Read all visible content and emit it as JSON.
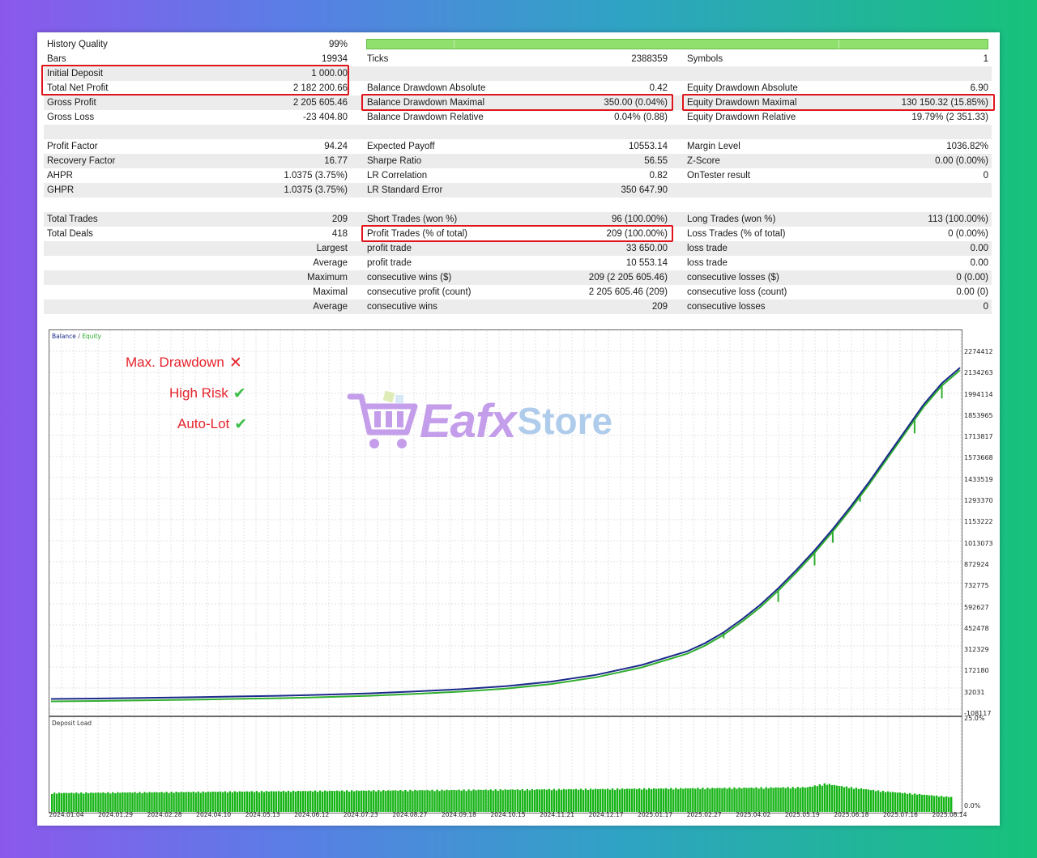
{
  "report": {
    "history_quality": {
      "label": "History Quality",
      "value": "99%"
    },
    "rows": [
      {
        "l1": "Bars",
        "v1": "19934",
        "l2": "Ticks",
        "v2": "2388359",
        "l3": "Symbols",
        "v3": "1",
        "shade": false
      },
      {
        "l1": "Initial Deposit",
        "v1": "1 000.00",
        "l2": "",
        "v2": "",
        "l3": "",
        "v3": "",
        "shade": true
      },
      {
        "l1": "Total Net Profit",
        "v1": "2 182 200.66",
        "l2": "Balance Drawdown Absolute",
        "v2": "0.42",
        "l3": "Equity Drawdown Absolute",
        "v3": "6.90",
        "shade": false
      },
      {
        "l1": "Gross Profit",
        "v1": "2 205 605.46",
        "l2": "Balance Drawdown Maximal",
        "v2": "350.00 (0.04%)",
        "l3": "Equity Drawdown Maximal",
        "v3": "130 150.32 (15.85%)",
        "shade": true
      },
      {
        "l1": "Gross Loss",
        "v1": "-23 404.80",
        "l2": "Balance Drawdown Relative",
        "v2": "0.04% (0.88)",
        "l3": "Equity Drawdown Relative",
        "v3": "19.79% (2 351.33)",
        "shade": false
      },
      {
        "l1": "",
        "v1": "",
        "l2": "",
        "v2": "",
        "l3": "",
        "v3": "",
        "shade": true
      },
      {
        "l1": "Profit Factor",
        "v1": "94.24",
        "l2": "Expected Payoff",
        "v2": "10553.14",
        "l3": "Margin Level",
        "v3": "1036.82%",
        "shade": false
      },
      {
        "l1": "Recovery Factor",
        "v1": "16.77",
        "l2": "Sharpe Ratio",
        "v2": "56.55",
        "l3": "Z-Score",
        "v3": "0.00 (0.00%)",
        "shade": true
      },
      {
        "l1": "AHPR",
        "v1": "1.0375 (3.75%)",
        "l2": "LR Correlation",
        "v2": "0.82",
        "l3": "OnTester result",
        "v3": "0",
        "shade": false
      },
      {
        "l1": "GHPR",
        "v1": "1.0375 (3.75%)",
        "l2": "LR Standard Error",
        "v2": "350 647.90",
        "l3": "",
        "v3": "",
        "shade": true
      },
      {
        "l1": "",
        "v1": "",
        "l2": "",
        "v2": "",
        "l3": "",
        "v3": "",
        "shade": false
      },
      {
        "l1": "Total Trades",
        "v1": "209",
        "l2": "Short Trades (won %)",
        "v2": "96 (100.00%)",
        "l3": "Long Trades (won %)",
        "v3": "113 (100.00%)",
        "shade": true
      },
      {
        "l1": "Total Deals",
        "v1": "418",
        "l2": "Profit Trades (% of total)",
        "v2": "209 (100.00%)",
        "l3": "Loss Trades (% of total)",
        "v3": "0 (0.00%)",
        "shade": false
      },
      {
        "lr": "Largest",
        "l2": "profit trade",
        "v2": "33 650.00",
        "l3": "loss trade",
        "v3": "0.00",
        "shade": true
      },
      {
        "lr": "Average",
        "l2": "profit trade",
        "v2": "10 553.14",
        "l3": "loss trade",
        "v3": "0.00",
        "shade": false
      },
      {
        "lr": "Maximum",
        "l2": "consecutive wins ($)",
        "v2": "209 (2 205 605.46)",
        "l3": "consecutive losses ($)",
        "v3": "0 (0.00)",
        "shade": true
      },
      {
        "lr": "Maximal",
        "l2": "consecutive profit (count)",
        "v2": "2 205 605.46 (209)",
        "l3": "consecutive loss (count)",
        "v3": "0.00 (0)",
        "shade": false
      },
      {
        "lr": "Average",
        "l2": "consecutive wins",
        "v2": "209",
        "l3": "consecutive losses",
        "v3": "0",
        "shade": true
      }
    ]
  },
  "annotations": [
    {
      "text": "Max. Drawdown",
      "icon": "cross-icon",
      "ok": false
    },
    {
      "text": "High Risk",
      "icon": "check-icon",
      "ok": true
    },
    {
      "text": "Auto-Lot",
      "icon": "check-icon",
      "ok": true
    }
  ],
  "watermark": {
    "part1": "Eafx",
    "part2": "Store"
  },
  "colors": {
    "balance": "#1b2a8a",
    "equity": "#2fae2f",
    "deposit": "#16b416",
    "redbox": "#e0151c"
  },
  "chart_data": [
    {
      "type": "line",
      "legend": [
        "Balance",
        "Equity"
      ],
      "y_ticks": [
        "2274412",
        "2134263",
        "1994114",
        "1853965",
        "1713817",
        "1573668",
        "1433519",
        "1293370",
        "1153222",
        "1013073",
        "872924",
        "732775",
        "592627",
        "452478",
        "312329",
        "172180",
        "32031",
        "-108117"
      ],
      "ylim": [
        -108117,
        2274412
      ],
      "x": [
        0,
        0.05,
        0.1,
        0.15,
        0.2,
        0.25,
        0.3,
        0.35,
        0.4,
        0.45,
        0.5,
        0.55,
        0.6,
        0.65,
        0.7,
        0.72,
        0.74,
        0.76,
        0.78,
        0.8,
        0.82,
        0.84,
        0.86,
        0.88,
        0.9,
        0.92,
        0.94,
        0.96,
        0.98,
        1.0
      ],
      "series": [
        {
          "name": "Balance",
          "values": [
            1000,
            4000,
            8000,
            12000,
            17000,
            22000,
            29000,
            38000,
            50000,
            65000,
            85000,
            115000,
            160000,
            225000,
            315000,
            370000,
            440000,
            525000,
            620000,
            730000,
            850000,
            980000,
            1120000,
            1270000,
            1430000,
            1600000,
            1770000,
            1940000,
            2080000,
            2182200
          ]
        }
      ],
      "equity_dips": [
        [
          0.74,
          400000
        ],
        [
          0.8,
          640000
        ],
        [
          0.84,
          880000
        ],
        [
          0.86,
          1030000
        ],
        [
          0.89,
          1300000
        ],
        [
          0.95,
          1750000
        ],
        [
          0.98,
          1980000
        ]
      ]
    },
    {
      "type": "bar",
      "title": "Deposit Load",
      "y_ticks": [
        "25.0%",
        "0.0%"
      ],
      "ylim": [
        0,
        25
      ],
      "segments": [
        [
          0,
          5.2
        ],
        [
          0.3,
          5.8
        ],
        [
          0.6,
          6.3
        ],
        [
          0.75,
          6.6
        ],
        [
          0.84,
          6.8
        ],
        [
          0.86,
          7.8
        ],
        [
          0.88,
          7.0
        ],
        [
          0.92,
          5.8
        ],
        [
          1.0,
          4.1
        ]
      ],
      "dates": [
        "2024.01.04",
        "2024.01.29",
        "2024.02.28",
        "2024.04.10",
        "2024.05.13",
        "2024.06.12",
        "2024.07.23",
        "2024.08.27",
        "2024.09.18",
        "2024.10.15",
        "2024.11.21",
        "2024.12.17",
        "2025.01.17",
        "2025.02.27",
        "2025.04.02",
        "2025.05.19",
        "2025.06.18",
        "2025.07.16",
        "2025.08.14"
      ]
    }
  ]
}
